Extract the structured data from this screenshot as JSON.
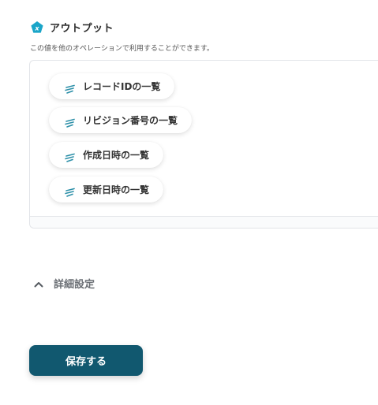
{
  "output_section": {
    "title": "アウトプット",
    "description": "この値を他のオペレーションで利用することができます。",
    "icon": "x-pentagon-icon",
    "icon_color": "#1aa5c8"
  },
  "chips": [
    {
      "label": "レコードIDの一覧",
      "icon": "feather-lines-icon"
    },
    {
      "label": "リビジョン番号の一覧",
      "icon": "feather-lines-icon"
    },
    {
      "label": "作成日時の一覧",
      "icon": "feather-lines-icon"
    },
    {
      "label": "更新日時の一覧",
      "icon": "feather-lines-icon"
    }
  ],
  "advanced_settings": {
    "label": "詳細設定",
    "icon": "chevron-up-icon",
    "expanded": true
  },
  "save_button": {
    "label": "保存する",
    "color": "#11586f"
  }
}
